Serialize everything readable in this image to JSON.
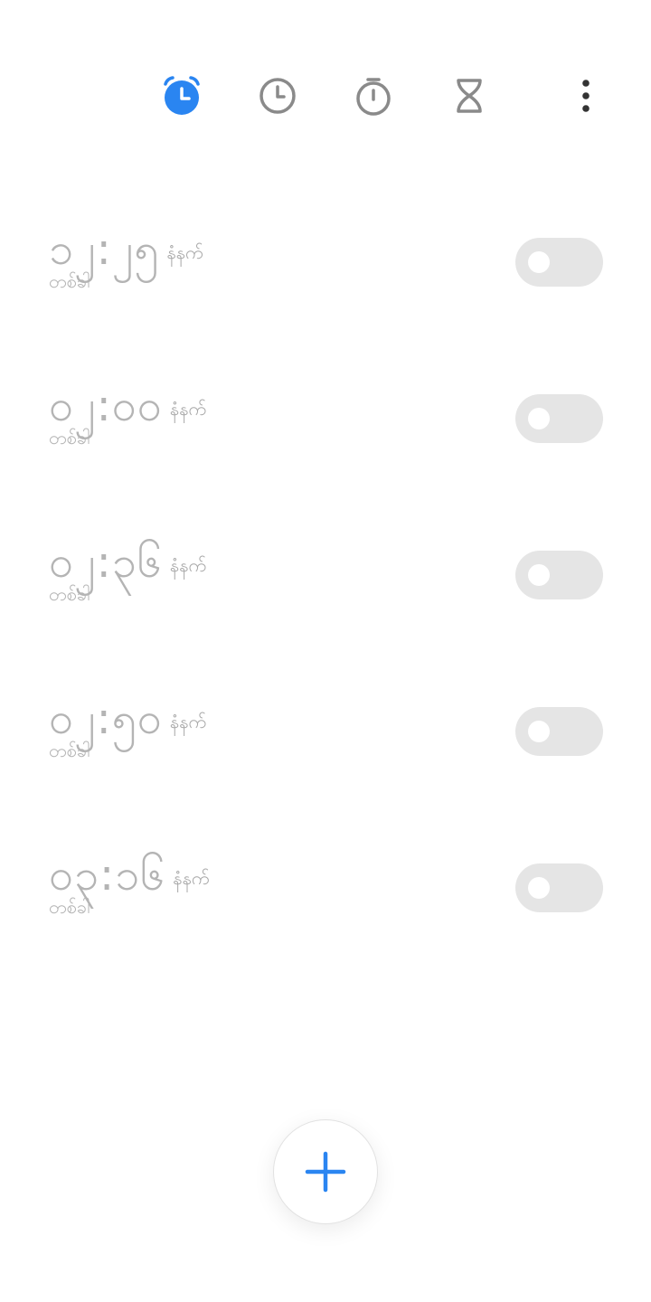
{
  "colors": {
    "accent": "#2a85f1",
    "inactive_icon": "#8a8a8a",
    "text_muted": "#b4b4b4",
    "toggle_off": "#e5e5e5"
  },
  "tabs": [
    {
      "name": "alarm",
      "icon": "alarm-clock-icon",
      "active": true
    },
    {
      "name": "world-clock",
      "icon": "clock-icon",
      "active": false
    },
    {
      "name": "stopwatch",
      "icon": "stopwatch-icon",
      "active": false
    },
    {
      "name": "timer",
      "icon": "hourglass-icon",
      "active": false
    }
  ],
  "more_icon": "more-vertical-icon",
  "alarms": [
    {
      "time": "၁၂:၂၅",
      "period": "နံနက်",
      "repeat": "တစ်ခါ",
      "enabled": false
    },
    {
      "time": "၀၂:၀၀",
      "period": "နံနက်",
      "repeat": "တစ်ခါ",
      "enabled": false
    },
    {
      "time": "၀၂:၃၆",
      "period": "နံနက်",
      "repeat": "တစ်ခါ",
      "enabled": false
    },
    {
      "time": "၀၂:၅၀",
      "period": "နံနက်",
      "repeat": "တစ်ခါ",
      "enabled": false
    },
    {
      "time": "၀၃:၁၆",
      "period": "နံနက်",
      "repeat": "တစ်ခါ",
      "enabled": false
    }
  ],
  "fab_icon": "plus-icon"
}
